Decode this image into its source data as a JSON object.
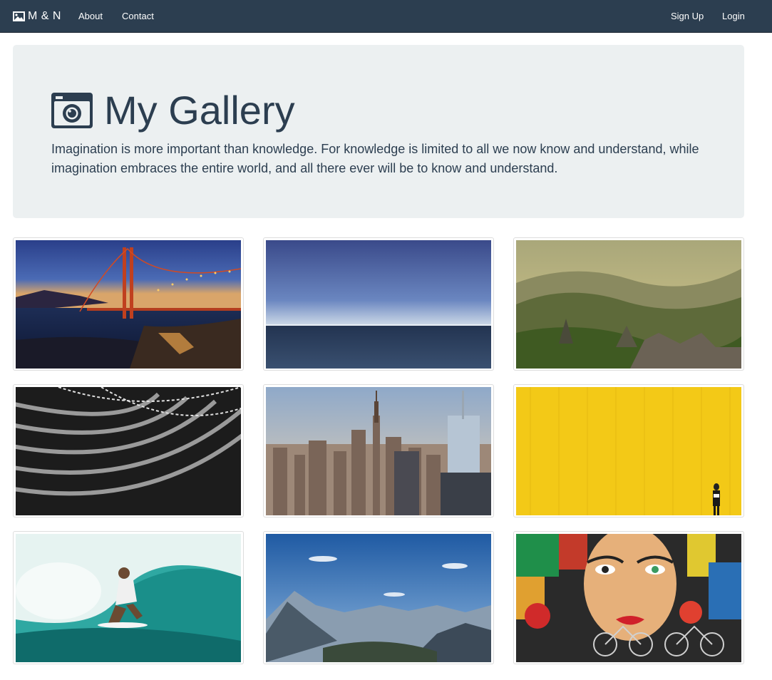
{
  "navbar": {
    "brand": "M & N",
    "brand_icon": "picture-icon",
    "links": [
      {
        "label": "About"
      },
      {
        "label": "Contact"
      }
    ],
    "right_links": [
      {
        "label": "Sign Up"
      },
      {
        "label": "Login"
      }
    ],
    "background": "#2c3e50"
  },
  "jumbotron": {
    "title": "My Gallery",
    "title_icon": "camera-icon",
    "lead": "Imagination is more important than knowledge. For knowledge is limited to all we now know and understand, while imagination embraces the entire world, and all there ever will be to know and understand.",
    "background": "#ecf0f1",
    "text_color": "#2c3e50"
  },
  "gallery": [
    {
      "subject": "golden-gate-bridge-at-dusk"
    },
    {
      "subject": "calm-ocean-horizon"
    },
    {
      "subject": "misty-mountain-valley"
    },
    {
      "subject": "abstract-black-white-architecture"
    },
    {
      "subject": "new-york-city-skyline"
    },
    {
      "subject": "yellow-wall-with-person"
    },
    {
      "subject": "surfer-in-wave"
    },
    {
      "subject": "mountain-range-blue-sky"
    },
    {
      "subject": "colorful-graffiti-face-with-bicycles"
    }
  ]
}
